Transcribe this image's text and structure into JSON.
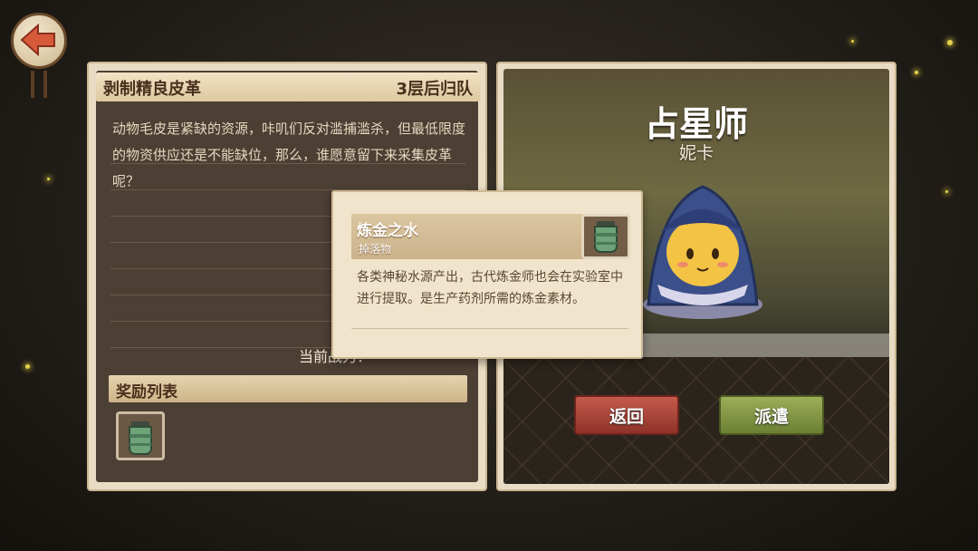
{
  "quest": {
    "title": "剥制精良皮革",
    "return_info": "3层后归队",
    "description": "动物毛皮是紧缺的资源，咔叽们反对滥捕滥杀，但最低限度的物资供应还是不能缺位，那么，谁愿意留下来采集皮革呢？",
    "power_label": "当前战力：",
    "reward_header": "奖励列表",
    "reward_items": [
      {
        "icon": "green-jar-icon"
      }
    ]
  },
  "hero": {
    "class_title": "占星师",
    "name": "妮卡"
  },
  "buttons": {
    "return_label": "返回",
    "dispatch_label": "派遣"
  },
  "tooltip": {
    "title": "炼金之水",
    "subtitle": "掉落物",
    "description": "各类神秘水源产出，古代炼金师也会在实验室中进行提取。是生产药剂所需的炼金素材。",
    "icon": "green-jar-icon"
  },
  "colors": {
    "panel_bg": "#4c3f33",
    "header_bg": "#e6d3ae",
    "return_button": "#a5433a",
    "dispatch_button": "#859444"
  }
}
